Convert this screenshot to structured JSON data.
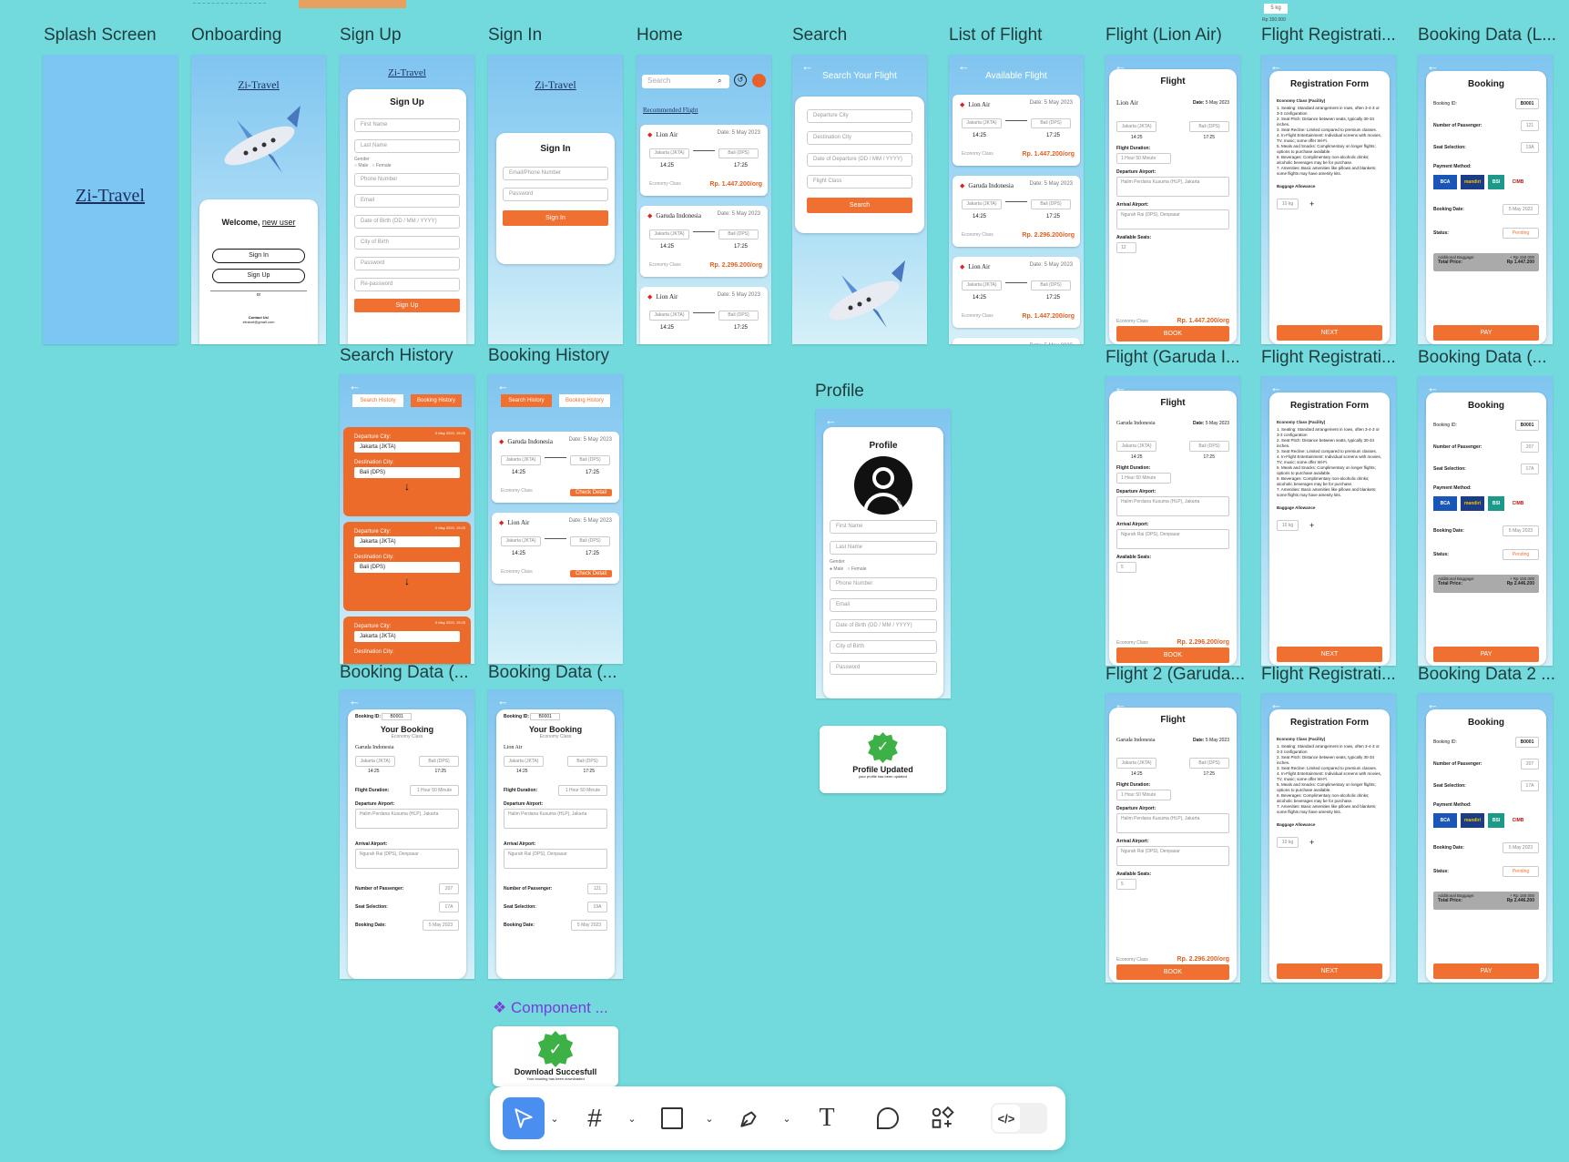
{
  "app": "Zi-Travel",
  "frames": {
    "splash": "Splash Screen",
    "onboarding": "Onboarding",
    "signup": "Sign Up",
    "signin": "Sign In",
    "home": "Home",
    "search": "Search",
    "list": "List of Flight",
    "flight_lion": "Flight (Lion Air)",
    "flight_reg1": "Flight Registrati...",
    "booking_data1": "Booking Data (L...",
    "search_history": "Search History",
    "booking_history": "Booking History",
    "profile": "Profile",
    "flight_garuda": "Flight (Garuda I...",
    "flight_reg2": "Flight Registrati...",
    "booking_data2": "Booking Data (...",
    "booking_data_g": "Booking Data (...",
    "booking_data_l": "Booking Data (...",
    "flight2_garuda": "Flight 2 (Garuda...",
    "flight_reg3": "Flight Registrati...",
    "booking_data3": "Booking Data 2 ...",
    "component": "Component ..."
  },
  "top_badge": {
    "weight": "5 kg",
    "price": "Rp 150.000"
  },
  "onboarding": {
    "welcome": "Welcome,",
    "new_user": "new user",
    "signin": "Sign In",
    "signup": "Sign Up",
    "or": "or",
    "contact": "Contact Us!",
    "email": "zitravel@gmail.com"
  },
  "signup": {
    "title": "Sign Up",
    "fields": [
      "First Name",
      "Last Name"
    ],
    "gender_label": "Gender",
    "male": "Male",
    "female": "Female",
    "fields2": [
      "Phone Number",
      "Email",
      "Date of Birth (DD / MM / YYYY)",
      "City of Birth",
      "Password",
      "Re-password"
    ],
    "button": "Sign Up"
  },
  "signin": {
    "title": "Sign In",
    "fields": [
      "Email/Phone Number",
      "Password"
    ],
    "button": "Sign In"
  },
  "home": {
    "search_placeholder": "Search",
    "recommended": "Recommended Flight"
  },
  "flights": [
    {
      "airline": "Lion Air",
      "date": "Date: 5 May 2023",
      "from": "Jakarta (JKTA)",
      "to": "Bali (DPS)",
      "dep": "14:25",
      "arr": "17:25",
      "class": "Economy Class",
      "price": "Rp. 1.447.200/org"
    },
    {
      "airline": "Garuda Indonesia",
      "date": "Date: 5 May 2023",
      "from": "Jakarta (JKTA)",
      "to": "Bali (DPS)",
      "dep": "14:25",
      "arr": "17:25",
      "class": "Economy Class",
      "price": "Rp. 2.296.200/org"
    },
    {
      "airline": "Lion Air",
      "date": "Date: 5 May 2023",
      "from": "Jakarta (JKTA)",
      "to": "Bali (DPS)",
      "dep": "14:25",
      "arr": "17:25",
      "class": "Economy Class",
      "price": "Rp. 1.447.200/org"
    }
  ],
  "search": {
    "header": "Search Your Flight",
    "fields": [
      "Departure City",
      "Destination City",
      "Date of Departure (DD / MM / YYYY)",
      "Flight Class"
    ],
    "button": "Search"
  },
  "list": {
    "header": "Available Flight"
  },
  "flight_detail": {
    "title": "Flight",
    "date_label": "Date:",
    "date": "5 May 2023",
    "duration_label": "Flight Duration:",
    "duration": "1 Hour 50 Minute",
    "dep_label": "Departure Airport:",
    "dep": "Halim Perdana Kusuma (HLP), Jakarta",
    "arr_label": "Arrival Airport:",
    "arr": "Ngurah Rai (DPS), Denpasar",
    "seats_label": "Available Seats:",
    "seats_lion": "12",
    "seats_garuda": "5",
    "class": "Economy Class",
    "price_lion": "Rp. 1.447.200/org",
    "price_garuda": "Rp. 2.296.200/org",
    "button": "BOOK"
  },
  "registration": {
    "title": "Registration Form",
    "subtitle": "Economy Class (Facility)",
    "items": [
      "1. Seating: Standard arrangement in rows, often 3-4-3 or 3-3 configuration",
      "2. Seat Pitch: Distance between seats, typically 30-34 inches.",
      "3. Seat Recline: Limited compared to premium classes.",
      "4. In-Flight Entertainment: Individual screens with movies, TV, music; some offer Wi-Fi.",
      "5. Meals and Snacks: Complimentary on longer flights; options to purchase available.",
      "6. Beverages: Complimentary non-alcoholic drinks; alcoholic beverages may be for purchase.",
      "7. Amenities: Basic amenities like pillows and blankets; some flights may have amenity kits."
    ],
    "baggage": "Baggage Allowance",
    "kg": "10 kg",
    "plus": "+",
    "button": "NEXT"
  },
  "booking": {
    "title": "Booking",
    "id_label": "Booking ID:",
    "id": "B0001",
    "pass_label": "Number of Passenger:",
    "pass_lion": "121",
    "pass_garuda": "207",
    "seat_label": "Seat Selection:",
    "seat_lion": "19A",
    "seat_garuda": "17A",
    "payment_label": "Payment Method:",
    "banks": [
      "BCA",
      "mandiri",
      "BSI",
      "CIMB"
    ],
    "date_label": "Booking Date:",
    "date": "5 May 2023",
    "status_label": "Status:",
    "status": "Pending",
    "extra_label": "Additional Baggage:",
    "extra": "+ Rp 150.000",
    "total_label": "Total Price:",
    "total_lion": "Rp 1.447.200",
    "total_garuda": "Rp 2.446.200",
    "button": "PAY"
  },
  "history": {
    "tab_search": "Search History",
    "tab_booking": "Booking History",
    "dep_label": "Departure City:",
    "dest_label": "Destination City:",
    "dep": "Jakarta (JKTA)",
    "dest": "Bali (DPS)",
    "date": "5 May 2023, 15:25",
    "check": "Check Detail"
  },
  "profile": {
    "title": "Profile",
    "fields": [
      "First Name",
      "Last Name"
    ],
    "gender": "Gender",
    "male": "Male",
    "female": "Female",
    "fields2": [
      "Phone Number",
      "Email",
      "Date of Birth (DD / MM / YYYY)",
      "City of Birth",
      "Password"
    ],
    "updated": "Profile Updated",
    "updated_sub": "your profile has been updated"
  },
  "your_booking": {
    "id_label": "Booking ID:",
    "id": "B0001",
    "title": "Your Booking",
    "class": "Economy Class",
    "pass_label": "Number of Passenger:",
    "seat_label": "Seat Selection:",
    "date_label": "Booking Date:"
  },
  "download": {
    "title": "Download Succesfull",
    "sub": "Your booking has been downloaded"
  },
  "toolbar": {
    "items": [
      "move-tool",
      "frame-tool",
      "rectangle-tool",
      "pen-tool",
      "text-tool",
      "comment-tool",
      "components-tool",
      "dev-mode"
    ]
  },
  "colors": {
    "canvas": "#72dadc",
    "accent": "#f07031",
    "sky": "#7fc4f0",
    "selected": "#4a8ff0"
  }
}
